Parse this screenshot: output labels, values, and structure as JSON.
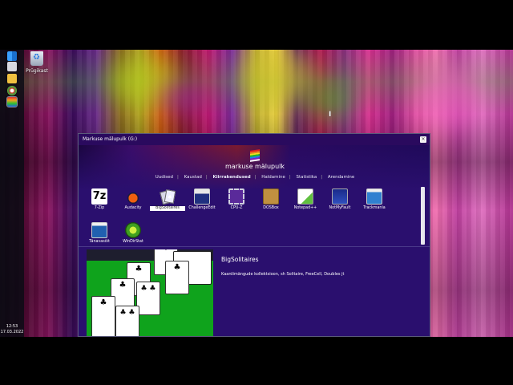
{
  "desktop": {
    "recycle_bin_label": "Prügikast",
    "clock_time": "12:53",
    "clock_date": "17.03.2022"
  },
  "window": {
    "title": "Markuse mälupulk (G:)",
    "close_glyph": "×",
    "app_title": "markuse mälupulk",
    "tabs": [
      {
        "label": "Uudised"
      },
      {
        "label": "Kaustad"
      },
      {
        "label": "Kiirrakendused"
      },
      {
        "label": "Haldamine"
      },
      {
        "label": "Statistika"
      },
      {
        "label": "Arendamine"
      }
    ],
    "active_tab": "Kiirrakendused",
    "apps": [
      {
        "label": "7-Zip",
        "icon": "7zip-icon"
      },
      {
        "label": "Audacity",
        "icon": "audacity-icon"
      },
      {
        "label": "BigSolitaires",
        "icon": "cards-icon"
      },
      {
        "label": "ChallengeEdit",
        "icon": "challengeedit-icon"
      },
      {
        "label": "CPU-Z",
        "icon": "cpu-icon"
      },
      {
        "label": "DOSBox",
        "icon": "dosbox-icon"
      },
      {
        "label": "Notepad++",
        "icon": "notepad-icon"
      },
      {
        "label": "NotMyFault",
        "icon": "notmyfault-icon"
      },
      {
        "label": "Trackmania",
        "icon": "trackmania-icon"
      },
      {
        "label": "Tänavasõit",
        "icon": "tanavasoit-icon"
      },
      {
        "label": "WinDirStat",
        "icon": "windirstat-icon"
      }
    ],
    "selected_app": "BigSolitaires",
    "detail": {
      "title": "BigSolitaires",
      "description": "Kaardimängude kollektsioon, sh Solitaire, FreeCell, Doubles jt"
    },
    "card_suits": [
      "♣",
      "♣",
      "♣",
      "♣",
      "♣"
    ]
  },
  "colors": {
    "window_bg": "#2a0f6e",
    "felt_green": "#0fa31c"
  }
}
